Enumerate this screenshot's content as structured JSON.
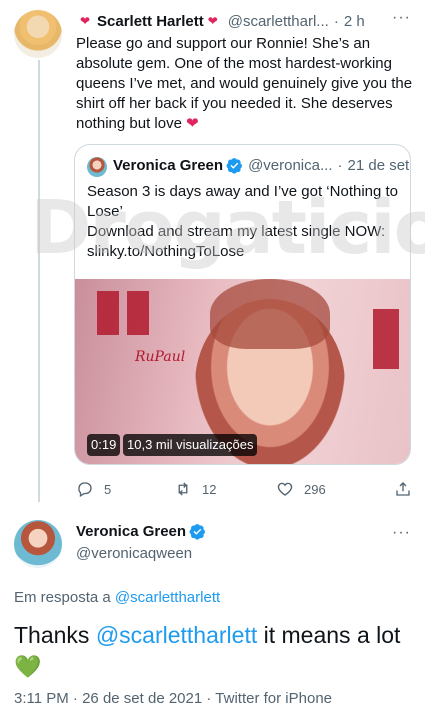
{
  "tweet": {
    "author_name": "Scarlett Harlett",
    "author_badge": "❤",
    "author_handle": "@scarlettharl...",
    "separator": "·",
    "age": "2 h",
    "text": "Please go and support our Ronnie! She’s an absolute gem. One of the most hardest-working queens I’ve met, and would genuinely give you the shirt off her back if you needed it. She deserves nothing but love",
    "emoji": "❤"
  },
  "quoted": {
    "author_name": "Veronica Green",
    "author_handle": "@veronica...",
    "separator": "·",
    "date": "21 de set",
    "line1": "Season 3 is days away and I’ve got ‘Nothing to Lose’",
    "line2": "Download and stream my latest single NOW:",
    "link": "slinky.to/NothingToLose",
    "media": {
      "logo_text": "RuPaul",
      "duration": "0:19",
      "views": "10,3 mil visualizações"
    }
  },
  "watermark": "Drogaticious",
  "actions": {
    "replies": "5",
    "retweets": "12",
    "likes": "296"
  },
  "reply": {
    "author_name": "Veronica Green",
    "author_handle": "@veronicaqween",
    "replying_prefix": "Em resposta a",
    "replying_to": "@scarlettharlett",
    "text_start": "Thanks",
    "text_mention": "@scarlettharlett",
    "text_end": "it means a lot",
    "emoji": "💚",
    "time": "3:11 PM",
    "date": "26 de set de 2021",
    "source": "Twitter for iPhone"
  },
  "colors": {
    "accent": "#1d9bf0",
    "muted": "#536471",
    "heart_red": "#e0245e",
    "heart_green": "#78b159"
  }
}
